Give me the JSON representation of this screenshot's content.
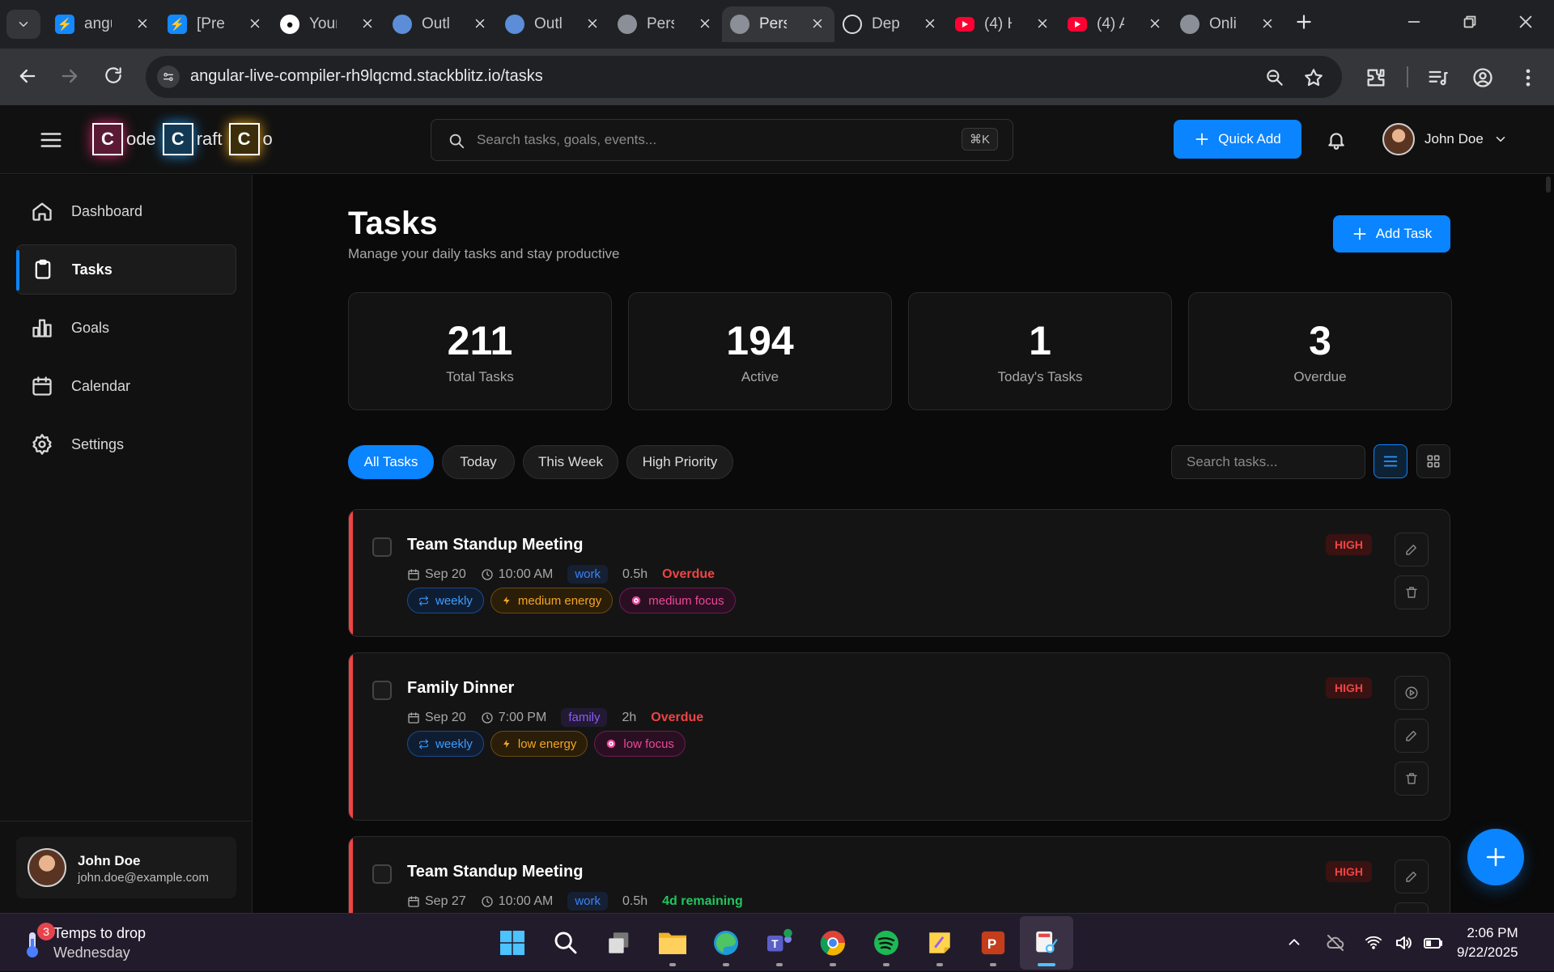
{
  "browser": {
    "tabs": [
      {
        "title": "angular",
        "favicon": "stackblitz-icon"
      },
      {
        "title": "[Preview]",
        "favicon": "stackblitz-icon"
      },
      {
        "title": "Your",
        "favicon": "github-icon"
      },
      {
        "title": "Outlook",
        "favicon": "outlook-icon"
      },
      {
        "title": "Outlook",
        "favicon": "outlook-icon"
      },
      {
        "title": "Personal",
        "favicon": "globe-icon"
      },
      {
        "title": "Personal",
        "favicon": "globe-icon"
      },
      {
        "title": "Deploy",
        "favicon": "openai-icon"
      },
      {
        "title": "(4) H",
        "favicon": "youtube-icon"
      },
      {
        "title": "(4) A",
        "favicon": "youtube-icon"
      },
      {
        "title": "Online",
        "favicon": "globe-icon"
      }
    ],
    "active_tab_index": 6,
    "url": "angular-live-compiler-rh9lqcmd.stackblitz.io/tasks"
  },
  "app": {
    "logo": [
      "C",
      "ode",
      "C",
      "raft",
      "C",
      "o"
    ],
    "search": {
      "placeholder": "Search tasks, goals, events...",
      "shortcut": "⌘K"
    },
    "quick_add": "Quick Add",
    "user": {
      "name": "John Doe",
      "email": "john.doe@example.com"
    }
  },
  "sidebar": {
    "items": [
      {
        "label": "Dashboard",
        "icon": "home-icon"
      },
      {
        "label": "Tasks",
        "icon": "clipboard-icon",
        "active": true
      },
      {
        "label": "Goals",
        "icon": "bar-chart-icon"
      },
      {
        "label": "Calendar",
        "icon": "calendar-icon"
      },
      {
        "label": "Settings",
        "icon": "gear-icon"
      }
    ]
  },
  "page": {
    "title": "Tasks",
    "subtitle": "Manage your daily tasks and stay productive",
    "add_task": "Add Task"
  },
  "stats": [
    {
      "value": "211",
      "label": "Total Tasks"
    },
    {
      "value": "194",
      "label": "Active"
    },
    {
      "value": "1",
      "label": "Today's Tasks"
    },
    {
      "value": "3",
      "label": "Overdue"
    }
  ],
  "filters": [
    "All Tasks",
    "Today",
    "This Week",
    "High Priority"
  ],
  "active_filter": "All Tasks",
  "task_search_placeholder": "Search tasks...",
  "view_mode": "list",
  "tasks": [
    {
      "title": "Team Standup Meeting",
      "date": "Sep 20",
      "time": "10:00 AM",
      "category": "work",
      "duration": "0.5h",
      "status": "Overdue",
      "priority": "HIGH",
      "tags": [
        "weekly",
        "medium energy",
        "medium focus"
      ]
    },
    {
      "title": "Family Dinner",
      "date": "Sep 20",
      "time": "7:00 PM",
      "category": "family",
      "duration": "2h",
      "status": "Overdue",
      "priority": "HIGH",
      "tags": [
        "weekly",
        "low energy",
        "low focus"
      ]
    },
    {
      "title": "Team Standup Meeting",
      "date": "Sep 27",
      "time": "10:00 AM",
      "category": "work",
      "duration": "0.5h",
      "status": "4d remaining",
      "priority": "HIGH"
    }
  ],
  "colors": {
    "accent": "#0a84ff",
    "danger": "#ef4444",
    "success": "#22c55e"
  },
  "taskbar": {
    "weather_badge": "3",
    "weather_line1": "Temps to drop",
    "weather_line2": "Wednesday",
    "time": "2:06 PM",
    "date": "9/22/2025"
  }
}
